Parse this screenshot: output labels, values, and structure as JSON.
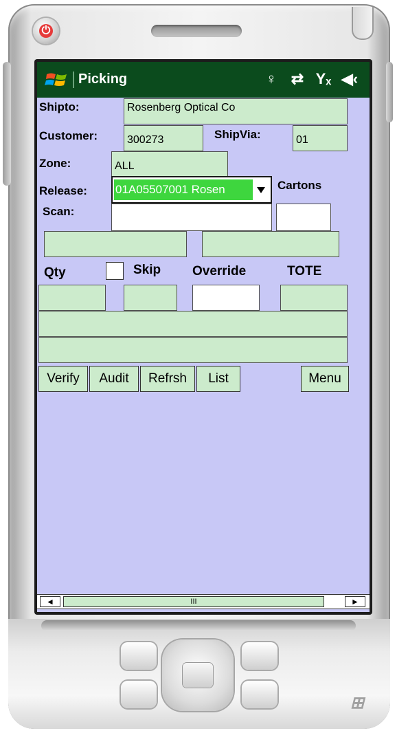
{
  "app": {
    "title": "Picking"
  },
  "status_icons": [
    "antenna-icon",
    "sync-icon",
    "signal-off-icon",
    "volume-mute-icon"
  ],
  "form": {
    "shipto_label": "Shipto:",
    "shipto_value": "Rosenberg Optical Co",
    "customer_label": "Customer:",
    "customer_value": "300273",
    "shipvia_label": "ShipVia:",
    "shipvia_value": "01",
    "zone_label": "Zone:",
    "zone_value": "ALL",
    "release_label": "Release:",
    "release_value": "01A05507001 Rosen",
    "cartons_label": "Cartons",
    "scan_label": "Scan:",
    "scan_value": "",
    "cartons_value": "",
    "qty_label": "Qty",
    "skip_label": "Skip",
    "override_label": "Override",
    "tote_label": "TOTE"
  },
  "buttons": {
    "verify": "Verify",
    "audit": "Audit",
    "refresh": "Refrsh",
    "list": "List",
    "menu": "Menu"
  },
  "scrollbar": {
    "left": "◄",
    "thumb": "III",
    "right": "►"
  },
  "colors": {
    "titlebar": "#0b4b1d",
    "screen_bg": "#c8c8f6",
    "field_bg": "#ccebcc",
    "selection": "#3ed63e"
  }
}
